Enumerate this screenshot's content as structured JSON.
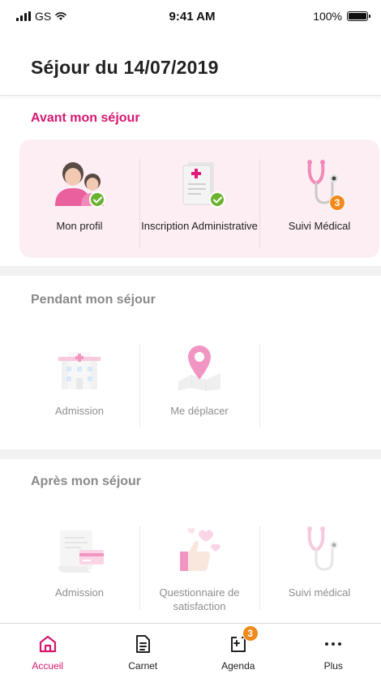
{
  "status_bar": {
    "carrier": "GS",
    "time": "9:41 AM",
    "battery": "100%",
    "battery_level": 1.0,
    "signal_icon": "signal-icon",
    "wifi_icon": "wifi-icon"
  },
  "header": {
    "title": "Séjour du 14/07/2019"
  },
  "colors": {
    "accent": "#d6186f",
    "active_card_bg": "#fdeef4",
    "check_green": "#6ab22f",
    "badge_orange": "#f08a1c",
    "muted_title": "#8a8a8a"
  },
  "sections": {
    "avant": {
      "title": "Avant mon séjour",
      "tiles": [
        {
          "label": "Mon profil",
          "icon": "family-profile-icon",
          "status": "check-icon"
        },
        {
          "label": "Inscription Administrative",
          "icon": "document-icon",
          "status": "check-icon"
        },
        {
          "label": "Suivi Médical",
          "icon": "stethoscope-icon",
          "badge": "3"
        }
      ]
    },
    "pendant": {
      "title": "Pendant mon séjour",
      "tiles": [
        {
          "label": "Admission",
          "icon": "hospital-icon"
        },
        {
          "label": "Me déplacer",
          "icon": "map-pin-icon"
        }
      ]
    },
    "apres": {
      "title": "Après mon séjour",
      "tiles": [
        {
          "label": "Admission",
          "icon": "receipt-icon"
        },
        {
          "label": "Questionnaire de satisfaction",
          "icon": "thumbs-up-hearts-icon"
        },
        {
          "label": "Suivi médical",
          "icon": "stethoscope-icon"
        }
      ]
    }
  },
  "bottom_nav": {
    "items": [
      {
        "label": "Accueil",
        "icon": "home-icon",
        "active": true
      },
      {
        "label": "Carnet",
        "icon": "notebook-icon"
      },
      {
        "label": "Agenda",
        "icon": "calendar-add-icon",
        "badge": "3"
      },
      {
        "label": "Plus",
        "icon": "more-dots-icon"
      }
    ]
  }
}
